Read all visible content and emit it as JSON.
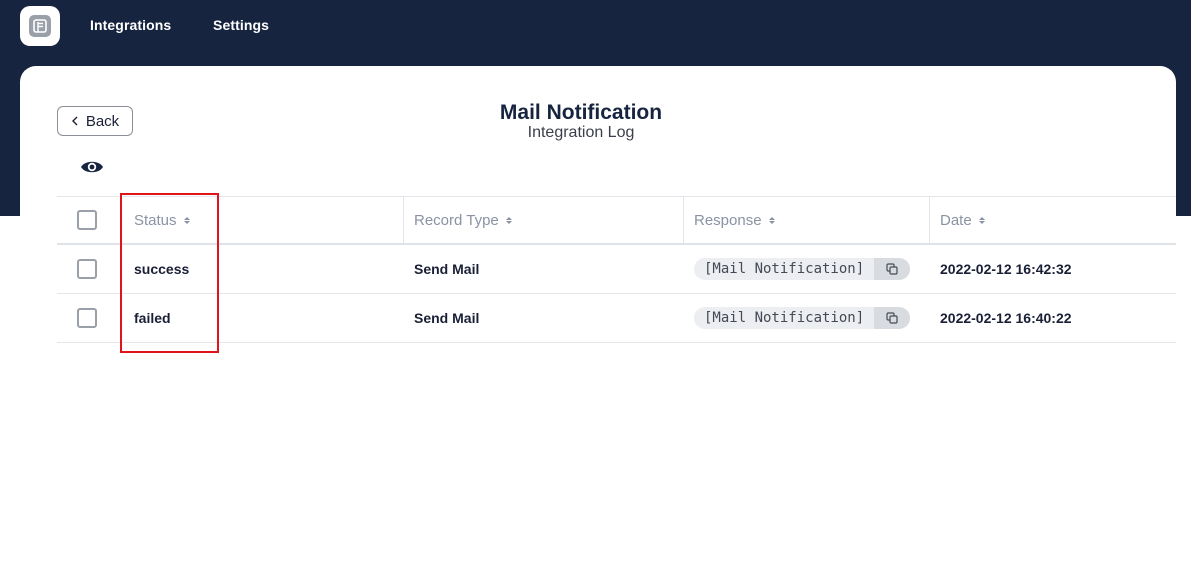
{
  "nav": {
    "items": [
      "Integrations",
      "Settings"
    ]
  },
  "header": {
    "back_label": "Back",
    "title": "Mail Notification",
    "subtitle": "Integration Log"
  },
  "table": {
    "columns": [
      "Status",
      "Record Type",
      "Response",
      "Date"
    ],
    "rows": [
      {
        "status": "success",
        "record_type": "Send Mail",
        "response": "[Mail Notification]",
        "date": "2022-02-12 16:42:32"
      },
      {
        "status": "failed",
        "record_type": "Send Mail",
        "response": "[Mail Notification]",
        "date": "2022-02-12 16:40:22"
      }
    ]
  },
  "colors": {
    "topbar": "#16243f",
    "highlight": "#e0141b"
  },
  "icons": {
    "logo": "app-logo-icon",
    "back": "chevron-left-icon",
    "view": "eye-icon",
    "sort": "sort-icon",
    "copy": "copy-icon"
  }
}
